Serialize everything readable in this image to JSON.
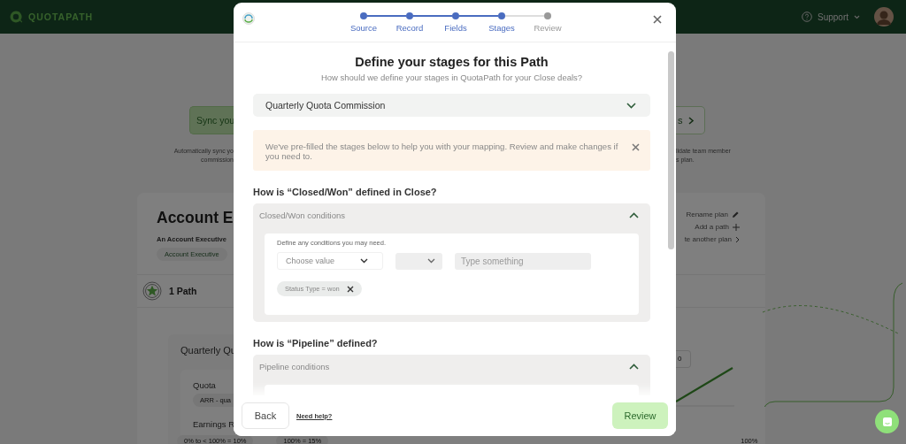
{
  "header": {
    "logo": "QUOTAPATH",
    "support": "Support"
  },
  "sync_banner": {
    "button": "Sync you",
    "caption_lines": [
      "Automatically sync yo",
      "commission"
    ]
  },
  "right_banner": {
    "button": "s",
    "caption_lines": [
      "lidate team member",
      "s plan."
    ]
  },
  "plan_card": {
    "title": "Account E",
    "description": "An Account Executive",
    "role_tag": "Account Executive",
    "actions": [
      "Rename plan",
      "Add a path",
      "te another plan"
    ],
    "path_count": "1 Path",
    "path": {
      "name": "Quarterly Qu",
      "quota_label": "Quota",
      "quota_tag": "ARR - qua",
      "earnings_label": "Earnings R",
      "value_box": "0",
      "rates": [
        "0% to < 100% = 10%",
        "100% = 15%"
      ],
      "rate_end": "100%"
    }
  },
  "modal": {
    "steps": [
      {
        "label": "Source",
        "completed": true
      },
      {
        "label": "Record",
        "completed": true
      },
      {
        "label": "Fields",
        "completed": true
      },
      {
        "label": "Stages",
        "completed": true
      },
      {
        "label": "Review",
        "completed": false
      }
    ],
    "title": "Define your stages for this Path",
    "subtitle": "How should we define your stages in QuotaPath for your Close deals?",
    "plan_select": "Quarterly Quota Commission",
    "notice": "We've pre-filled the stages below to help you with your mapping. Review and make changes if you need to.",
    "sections": [
      {
        "question": "How is “Closed/Won” defined in Close?",
        "conditions_label": "Closed/Won conditions",
        "expanded": true,
        "hint": "Define any conditions you may need.",
        "field_placeholder": "Choose value",
        "text_placeholder": "Type something",
        "filters": [
          "Status Type = won"
        ]
      },
      {
        "question": "How is “Pipeline” defined?",
        "conditions_label": "Pipeline conditions",
        "expanded": true
      }
    ],
    "back": "Back",
    "help_link": "Need help?",
    "next": "Review"
  }
}
